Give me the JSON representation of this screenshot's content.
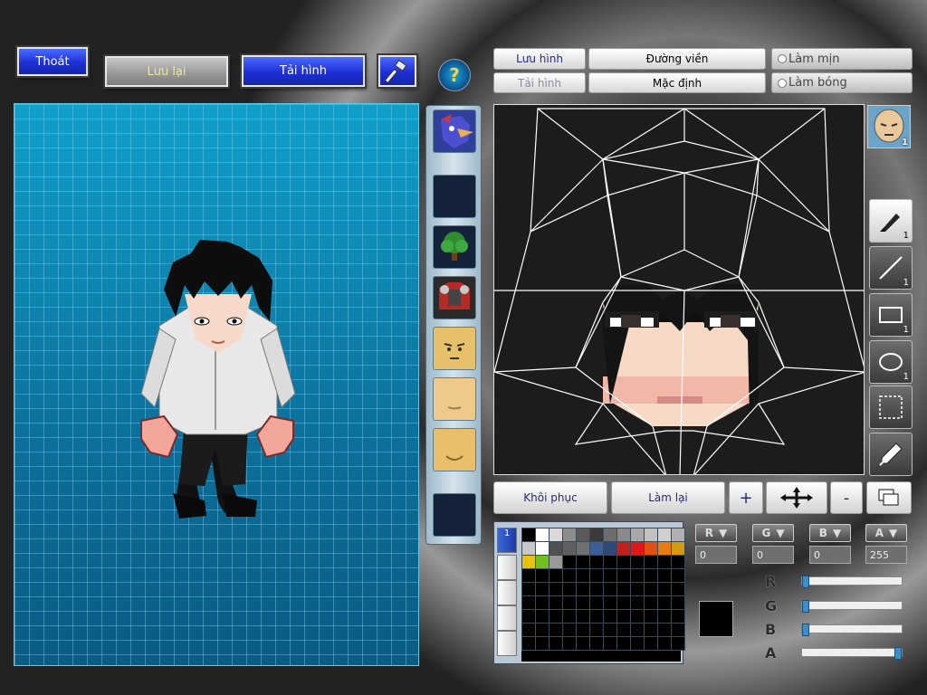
{
  "toolbar": {
    "exit_label": "Thoát",
    "save_label": "Lưu lại",
    "reload_label": "Tải hình",
    "help_glyph": "?"
  },
  "editor_tabs": {
    "save_tab": "Lưu hình",
    "load_tab": "Tải hình",
    "outline": "Đường viền",
    "default": "Mặc định",
    "smooth": "Làm mịn",
    "shine": "Làm bóng"
  },
  "edit_buttons": {
    "restore": "Khôi phục",
    "redo": "Làm lại",
    "plus": "+",
    "minus": "-"
  },
  "tools": [
    {
      "name": "brush-tool",
      "icon": "brush-icon",
      "count": "1",
      "active": true
    },
    {
      "name": "line-tool",
      "icon": "line-icon",
      "count": "1",
      "active": false
    },
    {
      "name": "rect-tool",
      "icon": "rectangle-icon",
      "count": "1",
      "active": false
    },
    {
      "name": "ellipse-tool",
      "icon": "ellipse-icon",
      "count": "1",
      "active": false
    },
    {
      "name": "select-tool",
      "icon": "marquee-icon",
      "count": "",
      "active": false
    },
    {
      "name": "eyedropper-tool",
      "icon": "eyedropper-icon",
      "count": "",
      "active": false
    }
  ],
  "face_thumb_count": "1",
  "palette": {
    "tab_active_label": "1",
    "colors": [
      "#000000",
      "#ffffff",
      "#d9d9d9",
      "#8c8c8c",
      "#5a5a5a",
      "#3a3a3a",
      "#6d6d6d",
      "#8a8a8a",
      "#a8a8a8",
      "#c2c2c2",
      "#cfcfcf",
      "#b0b0b0",
      "#c8c8c8",
      "#ffffff",
      "#505050",
      "#606060",
      "#707070",
      "#3c5f9a",
      "#2a4a7a",
      "#c02020",
      "#e01818",
      "#e05010",
      "#e87a10",
      "#d69a10",
      "#e6c20c",
      "#6fbf1f",
      "#9a9a9a"
    ]
  },
  "channels": {
    "r_label": "R",
    "g_label": "G",
    "b_label": "B",
    "a_label": "A",
    "r_value": "0",
    "g_value": "0",
    "b_value": "0",
    "a_value": "255",
    "r_level": 0,
    "g_level": 0,
    "b_level": 0,
    "a_level": 1.0
  },
  "current_color": "#000000"
}
